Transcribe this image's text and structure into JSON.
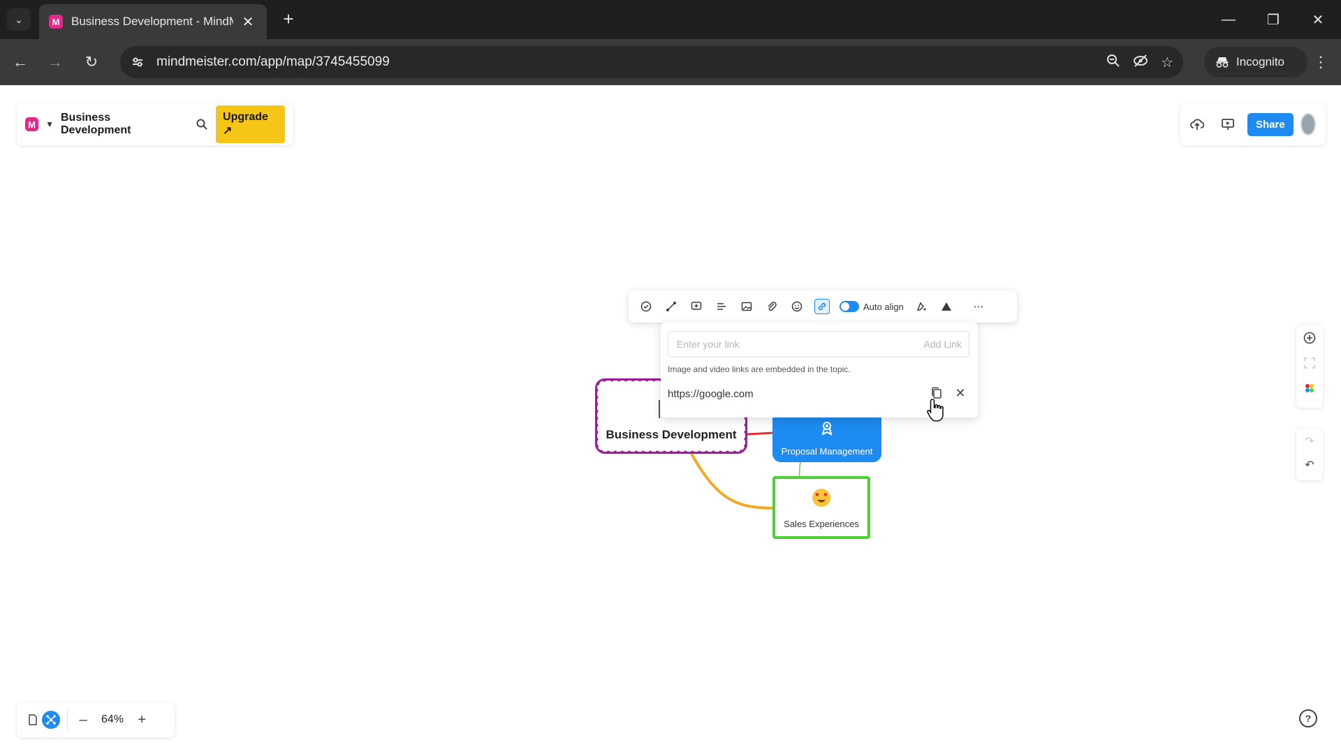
{
  "browser": {
    "tab_title": "Business Development - MindM",
    "tab_favicon": "M",
    "url": "mindmeister.com/app/map/3745455099",
    "incognito_label": "Incognito"
  },
  "app": {
    "logo": "M",
    "map_title": "Business Development",
    "upgrade_label": "Upgrade ↗",
    "share_label": "Share"
  },
  "toolbar": {
    "auto_align_label": "Auto align",
    "auto_align_on": true,
    "active_tool": "link"
  },
  "link_popover": {
    "input_placeholder": "Enter your link",
    "add_link_label": "Add Link",
    "hint": "Image and video links are embedded in the topic.",
    "current_link": "https://google.com"
  },
  "map": {
    "root_label": "Business Development",
    "nodes": [
      {
        "label": "Proposal Management",
        "icon": "award-icon",
        "color": "#1d8bf1"
      },
      {
        "label": "Sales Experiences",
        "icon": "heart-eyes-emoji",
        "color": "#4cd137"
      }
    ],
    "root_border_color": "#9c1c9c"
  },
  "zoom": {
    "value": "64%"
  }
}
